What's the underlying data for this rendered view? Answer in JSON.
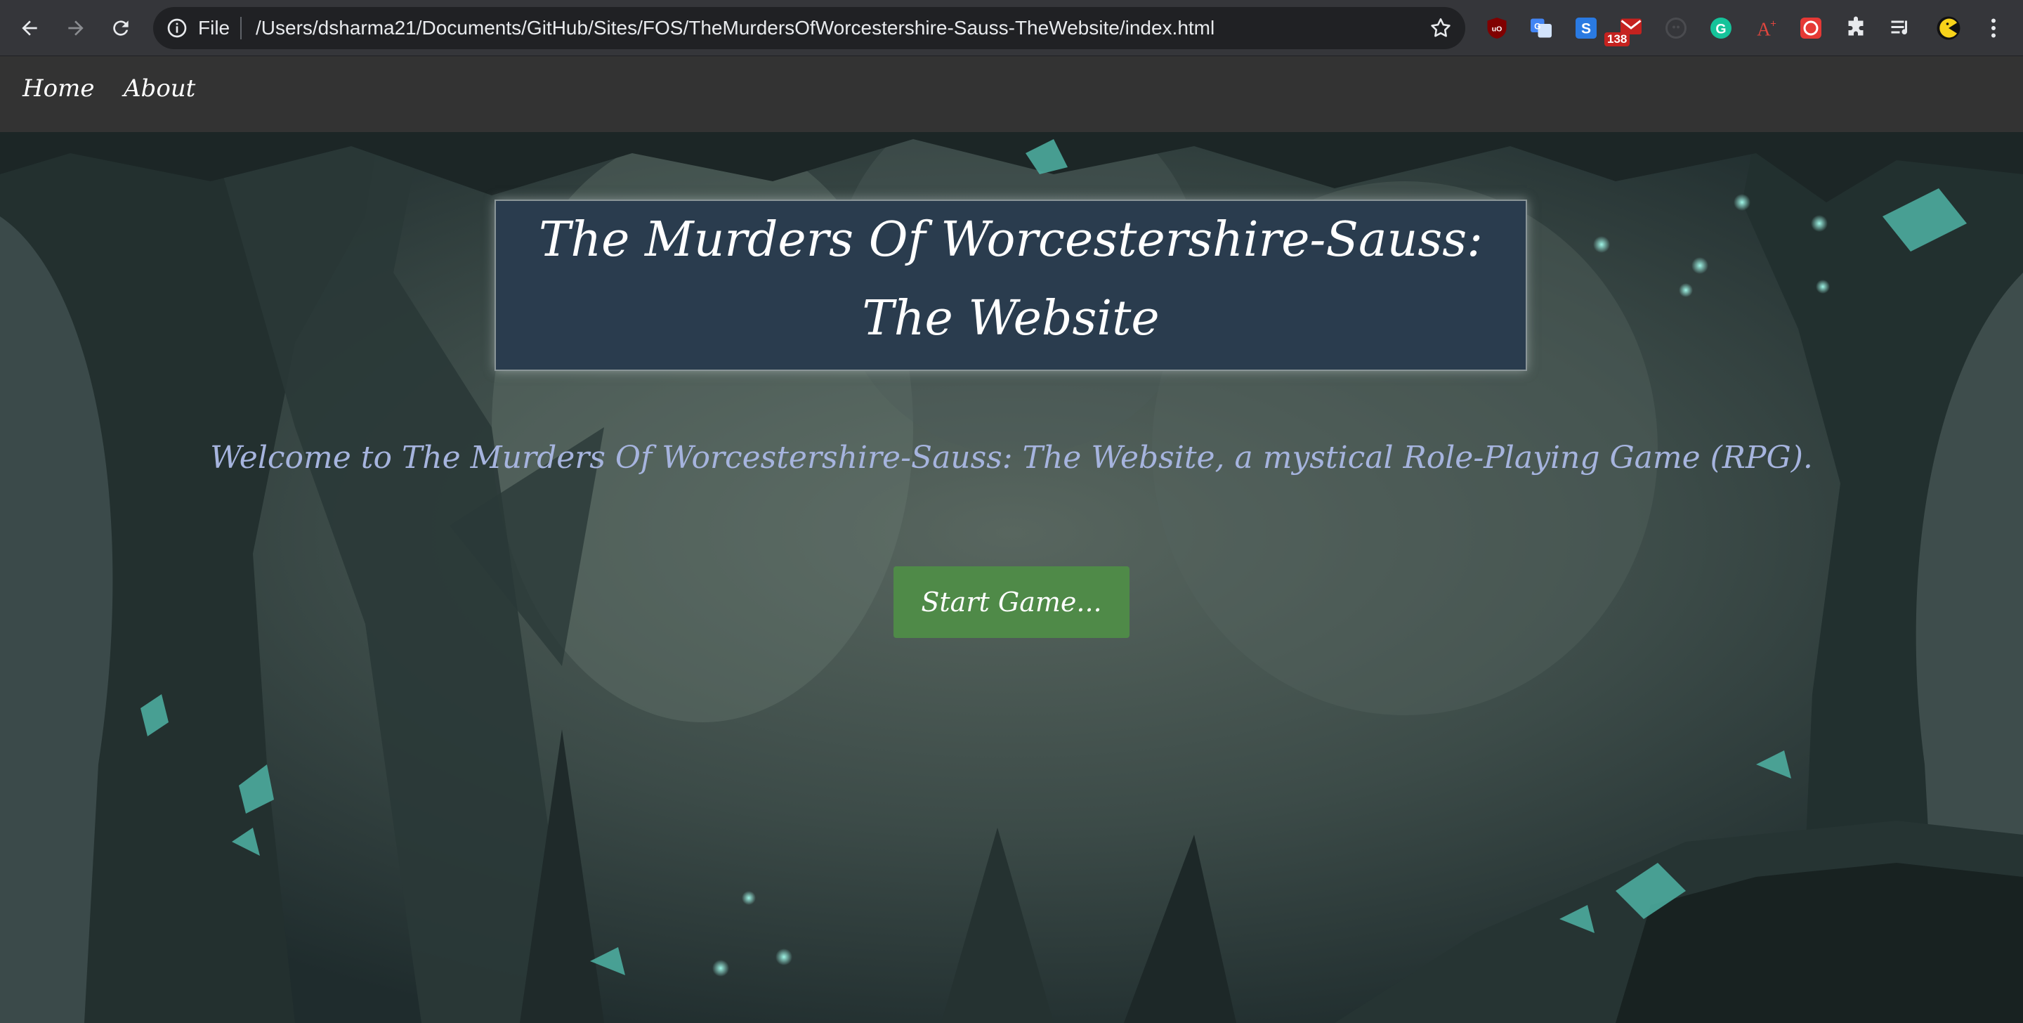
{
  "browser": {
    "scheme_label": "File",
    "url": "/Users/dsharma21/Documents/GitHub/Sites/FOS/TheMurdersOfWorcestershire-Sauss-TheWebsite/index.html",
    "gmail_badge": "138",
    "icons": [
      "back-icon",
      "forward-icon",
      "reload-icon",
      "info-icon",
      "star-icon",
      "ublock-icon",
      "translate-icon",
      "s-extension-icon",
      "gmail-icon",
      "ghost-icon",
      "grammarly-icon",
      "font-icon",
      "sketch-icon",
      "extensions-puzzle-icon",
      "media-queue-icon",
      "pacman-avatar-icon",
      "menu-dots-icon"
    ]
  },
  "nav": {
    "home": "Home",
    "about": "About"
  },
  "hero": {
    "title_line1": "The Murders Of Worcestershire-Sauss:",
    "title_line2": "The Website",
    "welcome": "Welcome to The Murders Of Worcestershire-Sauss: The Website, a mystical Role-Playing Game (RPG).",
    "start_label": "Start Game...",
    "colors": {
      "title_bg": "#2a3c4e",
      "welcome_text": "#a6b4de",
      "button_bg": "#4f8a48",
      "nav_bg": "#333333"
    }
  }
}
